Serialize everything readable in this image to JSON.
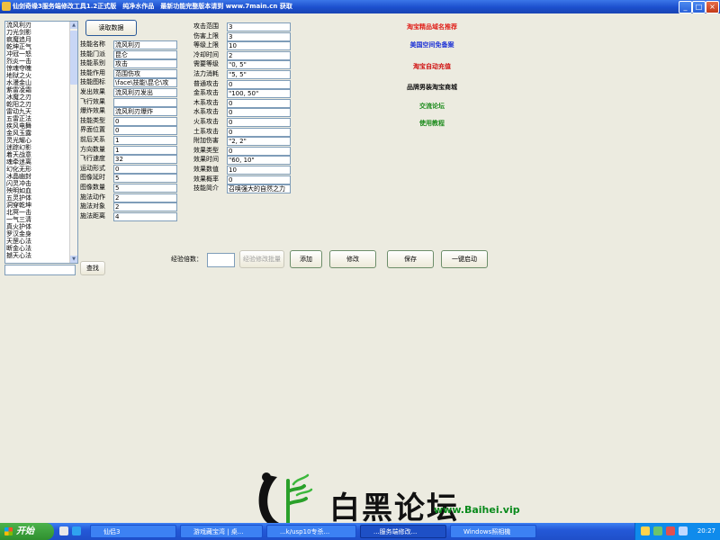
{
  "window": {
    "title": "仙剑奇缘3服务端修改工具1.2正式版　纯净水作品　最新功能完整版本请到 www.7main.cn 获取",
    "minimize": "_",
    "maximize": "□",
    "close": "×"
  },
  "skill_list": [
    "流风利刃",
    "刀光剑影",
    "疯魔追月",
    "乾坤正气",
    "冲冠一怒",
    "烈炎一击",
    "惊魂夺魄",
    "地狱之火",
    "水漫金山",
    "紫雷凌霜",
    "冰魔之刃",
    "乾阳之刃",
    "雷动九天",
    "五雷正法",
    "疾风电舞",
    "金风玉露",
    "灵光耀心",
    "迷踪幻影",
    "着天战意",
    "魂牵迷离",
    "幻化无形",
    "冰晶幽封",
    "闪灵冲击",
    "殃明如血",
    "五灵护体",
    "洞穿乾坤",
    "北冥一击",
    "一气三清",
    "真火护体",
    "罗汉金身",
    "天罡心法",
    "断金心法",
    "撼天心法"
  ],
  "buttons": {
    "read_data": "读取数据",
    "search": "查找",
    "exp_batch": "经验修改批量",
    "add": "添加",
    "modify": "修改",
    "save": "保存",
    "one_key_start": "一键启动"
  },
  "exp_multiplier_label": "经验倍数：",
  "fields_left": [
    {
      "label": "技能名称",
      "value": "流风利刃"
    },
    {
      "label": "技能门派",
      "value": "昆仑"
    },
    {
      "label": "技能系别",
      "value": "攻击"
    },
    {
      "label": "技能作用",
      "value": "范围伤攻"
    },
    {
      "label": "技能图标",
      "value": "\\face\\技能\\昆仑\\攻"
    },
    {
      "label": "发出效果",
      "value": "流风利刃发出"
    },
    {
      "label": "飞行效果",
      "value": ""
    },
    {
      "label": "爆炸效果",
      "value": "流风利刃爆炸"
    },
    {
      "label": "技能类型",
      "value": "0"
    },
    {
      "label": "界面位置",
      "value": "0"
    },
    {
      "label": "前后关系",
      "value": "1"
    },
    {
      "label": "方向数量",
      "value": "1"
    },
    {
      "label": "飞行速度",
      "value": "32"
    },
    {
      "label": "运动形式",
      "value": "0"
    },
    {
      "label": "图像延时",
      "value": "5"
    },
    {
      "label": "图像数量",
      "value": "5"
    },
    {
      "label": "施法动作",
      "value": "2"
    },
    {
      "label": "施法对象",
      "value": "2"
    },
    {
      "label": "施法距离",
      "value": "4"
    }
  ],
  "fields_right": [
    {
      "label": "攻击范围",
      "value": "3"
    },
    {
      "label": "伤害上限",
      "value": "3"
    },
    {
      "label": "等级上限",
      "value": "10"
    },
    {
      "label": "冷却时间",
      "value": "2"
    },
    {
      "label": "需要等级",
      "value": "\"0, 5\""
    },
    {
      "label": "法力消耗",
      "value": "\"5, 5\""
    },
    {
      "label": "普通攻击",
      "value": "0"
    },
    {
      "label": "金系攻击",
      "value": "\"100, 50\""
    },
    {
      "label": "木系攻击",
      "value": "0"
    },
    {
      "label": "水系攻击",
      "value": "0"
    },
    {
      "label": "火系攻击",
      "value": "0"
    },
    {
      "label": "土系攻击",
      "value": "0"
    },
    {
      "label": "附加伤害",
      "value": "\"2, 2\""
    },
    {
      "label": "效果类型",
      "value": "0"
    },
    {
      "label": "效果时间",
      "value": "\"60, 10\""
    },
    {
      "label": "效果数值",
      "value": "10"
    },
    {
      "label": "效果概率",
      "value": "0"
    },
    {
      "label": "技能简介",
      "value": "召唤强大的自然之力"
    }
  ],
  "promo_links": [
    {
      "text": "淘宝精品域名推荐",
      "color": "#e0201a"
    },
    {
      "text": "美国空间免备案",
      "color": "#1c32d6"
    },
    {
      "text": "淘宝自动充值",
      "color": "#d01010"
    },
    {
      "text": "品牌男装淘宝商城",
      "color": "#111111"
    },
    {
      "text": "交流论坛",
      "color": "#1a8a1a"
    },
    {
      "text": "使用教程",
      "color": "#1a8a1a"
    }
  ],
  "watermark": {
    "text": "白黑论坛",
    "url": "www.Baihei.vip"
  },
  "taskbar": {
    "start": "开始",
    "tasks": [
      "仙侣3",
      "游戏藏宝湾 | 桌...",
      "...k/usp10专杀...",
      "...服务端修改...",
      "Windows照相機"
    ],
    "clock": "20:27"
  }
}
